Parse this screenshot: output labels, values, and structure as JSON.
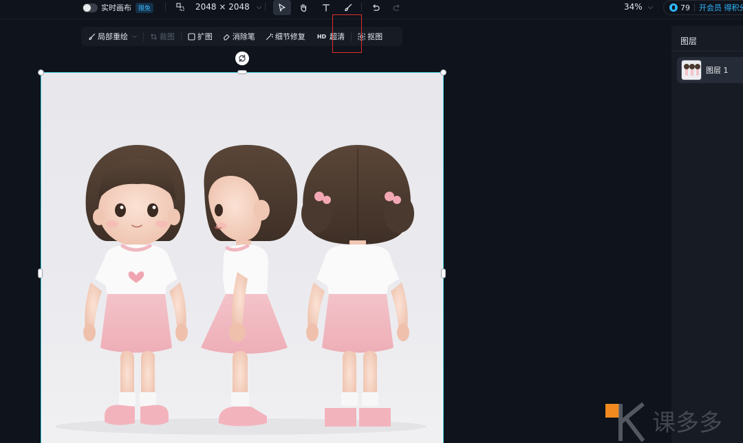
{
  "topbar": {
    "realtime_label": "实时画布",
    "free_badge": "限免",
    "canvas_size": "2048 × 2048",
    "zoom": "34%",
    "credits": "79",
    "member_text": "开会员 得积分"
  },
  "subbar": {
    "items": [
      {
        "label": "局部重绘",
        "icon": "brush-icon"
      },
      {
        "label": "扩图",
        "icon": "expand-icon"
      },
      {
        "label": "消除笔",
        "icon": "eraser-icon"
      },
      {
        "label": "细节修复",
        "icon": "magic-wand-icon"
      },
      {
        "label": "超清",
        "icon": "hd-icon",
        "tag": "HD"
      },
      {
        "label": "抠图",
        "icon": "cutout-icon"
      }
    ],
    "disabled_label": "裁图"
  },
  "panel": {
    "title": "图层",
    "layer_name": "图层 1"
  },
  "colors": {
    "accent": "#2fb6ff",
    "selection": "#38c9d6",
    "highlight": "#e0302e"
  },
  "watermark": {
    "text": "课多多"
  }
}
